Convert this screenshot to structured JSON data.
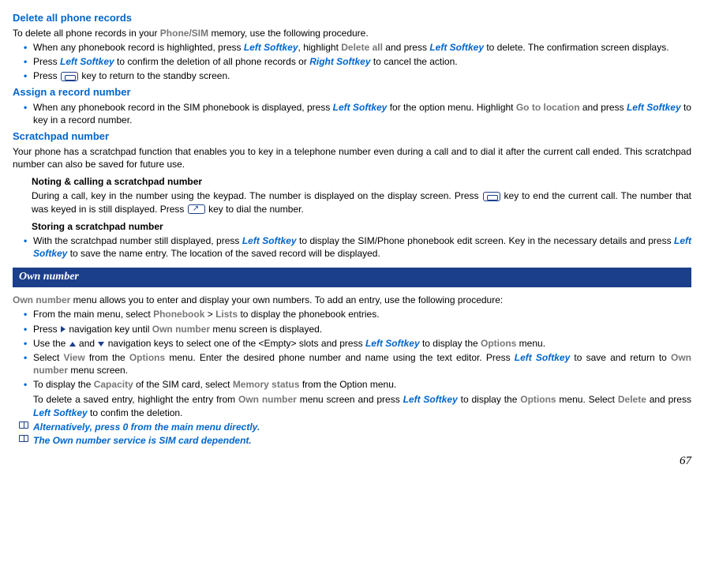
{
  "s1": {
    "title": "Delete all phone records",
    "intro_a": "To delete all phone records in your ",
    "intro_mem": "Phone/SIM",
    "intro_b": " memory, use the following procedure.",
    "b1_a": "When any phonebook record is highlighted, press ",
    "b1_ls": "Left Softkey",
    "b1_b": ", highlight ",
    "b1_del": "Delete all",
    "b1_c": " and press ",
    "b1_d": " to delete. The confirmation screen displays.",
    "b2_a": "Press ",
    "b2_b": " to confirm the deletion of all phone records or ",
    "b2_rs": "Right Softkey",
    "b2_c": " to cancel the action.",
    "b3_a": "Press ",
    "b3_b": " key to return to the standby screen."
  },
  "s2": {
    "title": "Assign a record number",
    "b1_a": "When any phonebook record in the SIM phonebook is displayed, press ",
    "b1_ls": "Left Softkey",
    "b1_b": " for the option menu. Highlight ",
    "b1_goto": "Go to location",
    "b1_c": " and press ",
    "b1_d": " to key in a record number."
  },
  "s3": {
    "title": "Scratchpad number",
    "intro": "Your phone has a scratchpad function that enables you to key in a telephone number even during a call and to dial it after the current call ended. This scratchpad number can also be saved for future use.",
    "sub1_title": "Noting & calling a scratchpad number",
    "sub1_a": "During a call, key in the number using the keypad. The number is displayed on the display screen. Press ",
    "sub1_b": " key to end the current call. The number that was keyed in is still displayed. Press ",
    "sub1_c": " key to dial the number.",
    "sub2_title": "Storing a scratchpad number",
    "sub2_b1_a": "With the scratchpad number still displayed, press ",
    "sub2_b1_ls": "Left Softkey",
    "sub2_b1_b": " to display the SIM/Phone phonebook edit screen. Key in the necessary details and press ",
    "sub2_b1_c": " to save the name entry. The location of the saved record will be displayed."
  },
  "bar": "Own number",
  "s4": {
    "intro_own": "Own number",
    "intro_a": " menu allows you to enter and display your own numbers. To add an entry, use the following procedure:",
    "b1_a": "From the main menu, select ",
    "b1_pb": "Phonebook",
    "b1_gt": " > ",
    "b1_lists": "Lists",
    "b1_b": " to display the phonebook entries.",
    "b2_a": "Press ",
    "b2_b": " navigation key until ",
    "b2_own": "Own number",
    "b2_c": " menu screen is displayed.",
    "b3_a": "Use the ",
    "b3_and": " and ",
    "b3_b": " navigation keys to select one of the <Empty> slots and press ",
    "b3_ls": "Left Softkey",
    "b3_c": " to display the ",
    "b3_opt": "Options",
    "b3_d": " menu.",
    "b4_a": "Select ",
    "b4_view": "View ",
    "b4_b": " from the ",
    "b4_opt": "Options",
    "b4_c": " menu. Enter the desired phone number and name using the text editor. Press ",
    "b4_ls": "Left Softkey",
    "b4_d": " to save and return to ",
    "b4_own": "Own number",
    "b4_e": " menu screen.",
    "b5_a": "To display the ",
    "b5_cap": "Capacity",
    "b5_b": " of the SIM card, select ",
    "b5_mem": "Memory status",
    "b5_c": " from the Option menu.",
    "del_a": "To delete a saved entry, highlight the entry from ",
    "del_own": "Own number",
    "del_b": " menu screen and press ",
    "del_ls": "Left Softkey",
    "del_c": " to display the ",
    "del_opt": "Options",
    "del_d": " menu. Select ",
    "del_del": "Delete",
    "del_e": " and press ",
    "del_f": " to confim the deletion."
  },
  "note1_a": "Alternatively, press ",
  "note1_digit": "0",
  "note1_b": " from the main menu directly.",
  "note2": "The Own number service is SIM card dependent.",
  "page": "67"
}
